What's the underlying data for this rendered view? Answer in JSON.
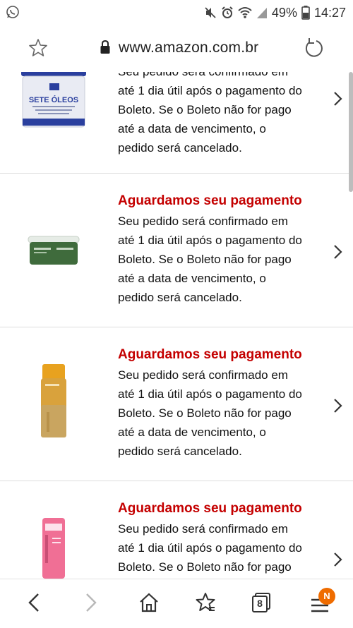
{
  "status_bar": {
    "battery_percent": "49%",
    "time": "14:27"
  },
  "browser": {
    "url": "www.amazon.com.br",
    "tab_count": "8",
    "menu_badge": "N"
  },
  "orders": [
    {
      "title": "",
      "product": "SETE ÓLEOS",
      "lines": [
        "Seu pedido será confirmado em",
        "até 1 dia útil após o pagamento do",
        "Boleto. Se o Boleto não for pago",
        "até a data de vencimento, o",
        "pedido será cancelado."
      ]
    },
    {
      "title": "Aguardamos seu pagamento",
      "lines": [
        "Seu pedido será confirmado em",
        "até 1 dia útil após o pagamento do",
        "Boleto. Se o Boleto não for pago",
        "até a data de vencimento, o",
        "pedido será cancelado."
      ]
    },
    {
      "title": "Aguardamos seu pagamento",
      "lines": [
        "Seu pedido será confirmado em",
        "até 1 dia útil após o pagamento do",
        "Boleto. Se o Boleto não for pago",
        "até a data de vencimento, o",
        "pedido será cancelado."
      ]
    },
    {
      "title": "Aguardamos seu pagamento",
      "lines": [
        "Seu pedido será confirmado em",
        "até 1 dia útil após o pagamento do",
        "Boleto. Se o Boleto não for pago"
      ]
    }
  ],
  "colors": {
    "title_red": "#c40000",
    "badge_orange": "#ef6c00"
  }
}
